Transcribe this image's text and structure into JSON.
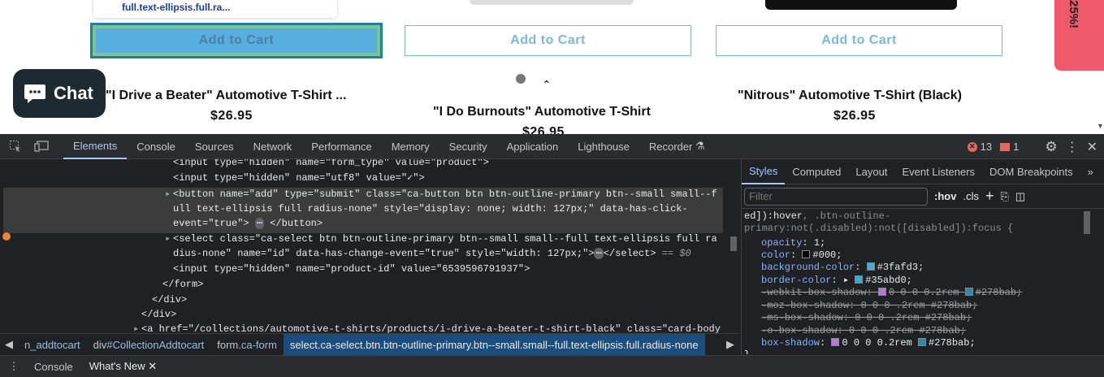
{
  "page": {
    "tooltip": "full.text-ellipsis.full.ra...",
    "add_to_cart": [
      "Add to Cart",
      "Add to Cart",
      "Add to Cart"
    ],
    "chat_label": "Chat",
    "products": [
      {
        "title": "\"I Drive a Beater\" Automotive T-Shirt ...",
        "price": "$26.95"
      },
      {
        "title": "\"I Do Burnouts\" Automotive T-Shirt",
        "price": "$26.95"
      },
      {
        "title": "\"Nitrous\" Automotive T-Shirt (Black)",
        "price": "$26.95"
      }
    ],
    "promo_text": "25%!",
    "colors": {
      "accent": "#7ab8d4",
      "chat_bg": "#1e2a32",
      "promo": "#ee5a6a"
    }
  },
  "devtools": {
    "tabs": [
      "Elements",
      "Console",
      "Sources",
      "Network",
      "Performance",
      "Memory",
      "Security",
      "Application",
      "Lighthouse",
      "Recorder"
    ],
    "active_tab": "Elements",
    "errors": "13",
    "issues": "1",
    "code_lines": [
      "<input type=\"hidden\" name=\"form_type\" value=\"product\">",
      "<input type=\"hidden\" name=\"utf8\" value=\"✓\">",
      "<button name=\"add\" type=\"submit\" class=\"ca-button btn btn-outline-primary btn--small small--f",
      "ull text-ellipsis full radius-none\" style=\"display: none; width: 127px;\" data-has-click-",
      "event=\"true\">",
      "</button>",
      "<select class=\"ca-select btn btn-outline-primary btn--small small--full text-ellipsis full ra",
      "dius-none\" name=\"id\" data-has-change-event=\"true\" style=\"width: 127px;\">",
      "</select>",
      "== $0",
      "<input type=\"hidden\" name=\"product-id\" value=\"6539596791937\">",
      "</form>",
      "</div>",
      "</div>",
      "<a href=\"/collections/automotive-t-shirts/products/i-drive-a-beater-t-shirt-black\" class=\"card-body"
    ],
    "breadcrumbs": [
      {
        "pre": "",
        "label": "n_addtocart"
      },
      {
        "pre": "div",
        "label": "#CollectionAddtocart"
      },
      {
        "pre": "form",
        "label": ".ca-form"
      },
      {
        "pre": "select",
        "label": ".ca-select.btn.btn-outline-primary.btn--small.small--full.text-ellipsis.full.radius-none"
      }
    ],
    "styles": {
      "tabs": [
        "Styles",
        "Computed",
        "Layout",
        "Event Listeners",
        "DOM Breakpoints"
      ],
      "filter_placeholder": "Filter",
      "hov": ":hov",
      "cls": ".cls",
      "selector_1": "ed]):hover",
      "selector_1b": ", .btn-outline-",
      "selector_2": "primary:not(.disabled):not([disabled]):focus {",
      "props": [
        {
          "name": "opacity",
          "value": "1;"
        },
        {
          "name": "color",
          "value": "#000;",
          "swatch": "#000000"
        },
        {
          "name": "background-color",
          "value": "#3fafd3;",
          "swatch": "#3fafd3"
        },
        {
          "name": "border-color",
          "value": "#35abd0;",
          "swatch": "#35abd0"
        },
        {
          "name": "-webkit-box-shadow",
          "value": "0 0 0 0.2rem",
          "value2": "#278bab;",
          "swatch": "#278bab"
        },
        {
          "name": "-moz-box-shadow",
          "value": "0 0 0 .2rem #278bab;"
        },
        {
          "name": "-ms-box-shadow",
          "value": "0 0 0 .2rem #278bab;"
        },
        {
          "name": "-o-box-shadow",
          "value": "0 0 0 .2rem #278bab;"
        },
        {
          "name": "box-shadow",
          "value": "0 0 0 0.2rem",
          "value2": "#278bab;",
          "swatch": "#278bab"
        }
      ],
      "close_brace": "}"
    },
    "drawer_tabs": [
      "Console",
      "What's New"
    ]
  }
}
